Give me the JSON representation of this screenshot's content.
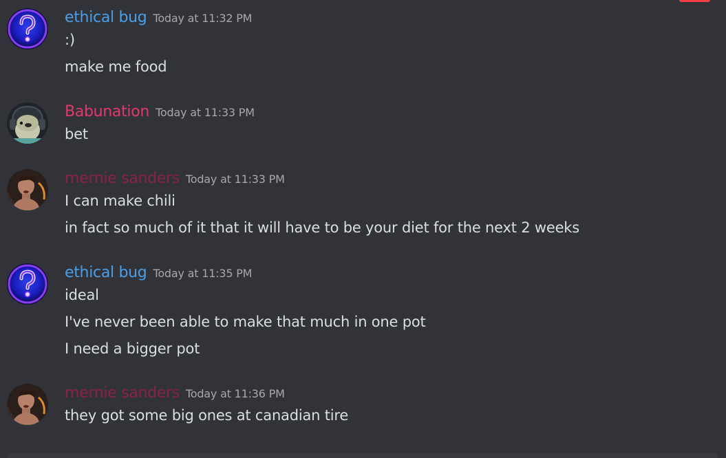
{
  "colors": {
    "background": "#313338",
    "message_text": "#dbdee1",
    "timestamp": "#a6a8ad",
    "notification_red": "#f23f43"
  },
  "messages": [
    {
      "author": "ethical bug",
      "author_color": "#4b9ee6",
      "avatar": "question-mark-orb",
      "timestamp": "Today at 11:32 PM",
      "lines": [
        ":)",
        "make me food"
      ]
    },
    {
      "author": "Babunation",
      "author_color": "#e3386b",
      "avatar": "creature-with-headphones",
      "timestamp": "Today at 11:33 PM",
      "lines": [
        "bet"
      ]
    },
    {
      "author": "mernie sanders",
      "author_color": "#8a2244",
      "avatar": "man-portrait",
      "timestamp": "Today at 11:33 PM",
      "lines": [
        "I can make chili",
        "in fact so much of it that it will have to be your diet for the next 2 weeks"
      ]
    },
    {
      "author": "ethical bug",
      "author_color": "#4b9ee6",
      "avatar": "question-mark-orb",
      "timestamp": "Today at 11:35 PM",
      "lines": [
        "ideal",
        "I've never been able to make that much in one pot",
        "I need a bigger pot"
      ]
    },
    {
      "author": "mernie sanders",
      "author_color": "#8a2244",
      "avatar": "man-portrait",
      "timestamp": "Today at 11:36 PM",
      "lines": [
        "they got some big ones at canadian tire"
      ]
    }
  ]
}
